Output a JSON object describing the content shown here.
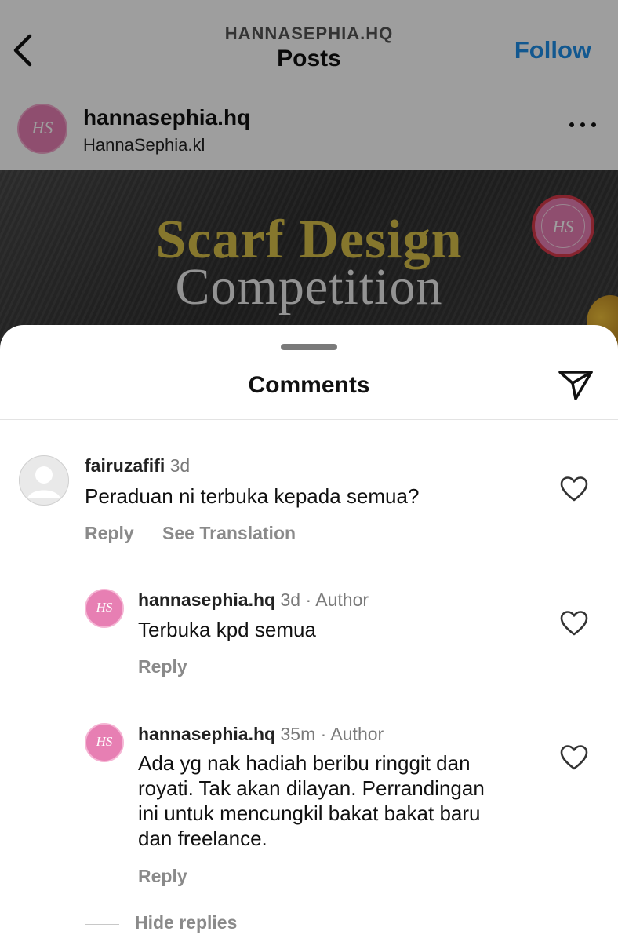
{
  "header": {
    "account_caps": "HANNASEPHIA.HQ",
    "title": "Posts",
    "follow_label": "Follow",
    "back_icon": "chevron-left-icon"
  },
  "post": {
    "username": "hannasephia.hq",
    "location": "HannaSephia.kl",
    "more_icon": "more-horizontal-icon",
    "image": {
      "title_line1": "Scarf Design",
      "title_line2": "Competition",
      "badge_monogram": "HS"
    }
  },
  "sheet": {
    "title": "Comments",
    "share_icon": "paper-plane-icon"
  },
  "comments": [
    {
      "username": "fairuzafifi",
      "time": "3d",
      "author_tag": "",
      "text_lines": [
        "Peraduan ni terbuka kepada semua?"
      ],
      "actions": [
        "Reply",
        "See Translation"
      ]
    },
    {
      "username": "hannasephia.hq",
      "time": "3d",
      "author_tag": "Author",
      "monogram": "HS",
      "text_lines": [
        "Terbuka kpd semua"
      ],
      "actions": [
        "Reply"
      ]
    },
    {
      "username": "hannasephia.hq",
      "time": "35m",
      "author_tag": "Author",
      "monogram": "HS",
      "text_lines": [
        "Ada yg nak hadiah beribu ringgit dan",
        "royati. Tak akan dilayan. Perrandingan",
        "ini untuk mencungkil bakat bakat baru",
        "dan freelance."
      ],
      "actions": [
        "Reply"
      ]
    }
  ],
  "hide_replies_label": "Hide replies",
  "colors": {
    "follow_blue": "#1d8fe8",
    "brand_pink": "#e77fb3",
    "title_gold": "#d8c04a",
    "muted_text": "#7a7a7a"
  }
}
